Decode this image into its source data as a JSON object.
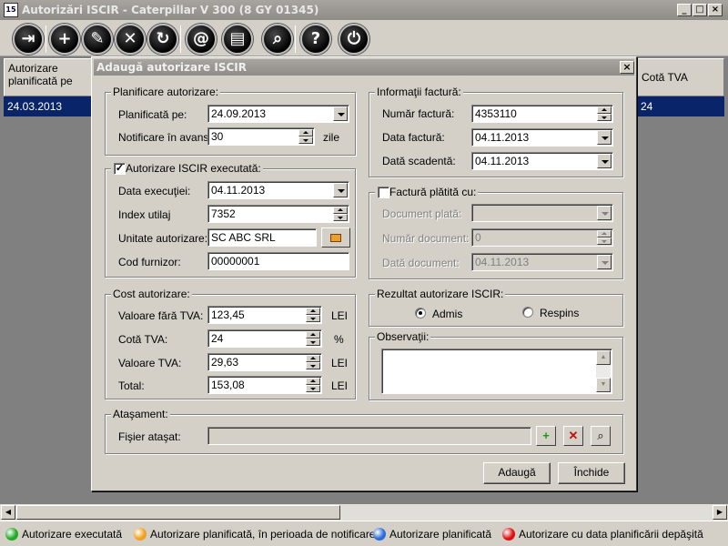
{
  "window": {
    "title": "Autorizări ISCIR - Caterpillar  V 300 (8 GY 01345)",
    "icon_label": "15",
    "controls": {
      "minimize": "_",
      "maximize": "□",
      "close": "×"
    }
  },
  "toolbar": {
    "buttons": [
      {
        "name": "exit-icon",
        "glyph": "⇥"
      },
      {
        "name": "add-icon",
        "glyph": "+"
      },
      {
        "name": "edit-icon",
        "glyph": "✎"
      },
      {
        "name": "delete-icon",
        "glyph": "✕"
      },
      {
        "name": "refresh-icon",
        "glyph": "↻"
      },
      {
        "name": "email-icon",
        "glyph": "@"
      },
      {
        "name": "print-icon",
        "glyph": "▤"
      },
      {
        "name": "search-icon",
        "glyph": "⌕"
      },
      {
        "name": "help-icon",
        "glyph": "?"
      },
      {
        "name": "power-icon",
        "glyph": "⏻"
      }
    ]
  },
  "grid": {
    "col_left_header": "Autorizare planificată pe",
    "col_right_header": "Cotă TVA",
    "row": {
      "left": "24.03.2013",
      "right": "24"
    }
  },
  "legend": [
    {
      "label": "Autorizare executată",
      "color": "#22aa22"
    },
    {
      "label": "Autorizare planificată, în perioada de notificare",
      "color": "#f0a020"
    },
    {
      "label": "Autorizare planificată",
      "color": "#2a6cd8"
    },
    {
      "label": "Autorizare cu data planificării depăşită",
      "color": "#dd1111"
    }
  ],
  "dialog": {
    "title": "Adaugă autorizare ISCIR",
    "close": "×",
    "planificare": {
      "title": "Planificare autorizare:",
      "planificata_label": "Planificată pe:",
      "planificata_value": "24.09.2013",
      "notificare_label": "Notificare în avans:",
      "notificare_value": "30",
      "notificare_unit": "zile"
    },
    "executata": {
      "title": "Autorizare ISCIR executată:",
      "checked": "✓",
      "data_label": "Data execuţiei:",
      "data_value": "04.11.2013",
      "index_label": "Index utilaj",
      "index_value": "7352",
      "unitate_label": "Unitate autorizare:",
      "unitate_value": "SC ABC SRL",
      "cod_label": "Cod furnizor:",
      "cod_value": "00000001"
    },
    "cost": {
      "title": "Cost autorizare:",
      "valoare_label": "Valoare fără TVA:",
      "valoare_value": "123,45",
      "valoare_unit": "LEI",
      "cota_label": "Cotă TVA:",
      "cota_value": "24",
      "cota_unit": "%",
      "vtva_label": "Valoare TVA:",
      "vtva_value": "29,63",
      "vtva_unit": "LEI",
      "total_label": "Total:",
      "total_value": "153,08",
      "total_unit": "LEI"
    },
    "factura": {
      "title": "Informaţii factură:",
      "numar_label": "Număr factură:",
      "numar_value": "4353110",
      "data_label": "Data factură:",
      "data_value": "04.11.2013",
      "scadenta_label": "Dată scadentă:",
      "scadenta_value": "04.11.2013"
    },
    "platita": {
      "title": "Factură plătită cu:",
      "doc_label": "Document plată:",
      "doc_value": "",
      "nr_label": "Număr document:",
      "nr_value": "0",
      "data_label": "Dată document:",
      "data_value": "04.11.2013"
    },
    "rezultat": {
      "title": "Rezultat autorizare ISCIR:",
      "admis": "Admis",
      "respins": "Respins"
    },
    "observatii": {
      "title": "Observaţii:"
    },
    "atasament": {
      "title": "Ataşament:",
      "fisier_label": "Fişier ataşat:",
      "fisier_value": ""
    },
    "buttons": {
      "adauga": "Adaugă",
      "inchide": "Închide"
    }
  }
}
